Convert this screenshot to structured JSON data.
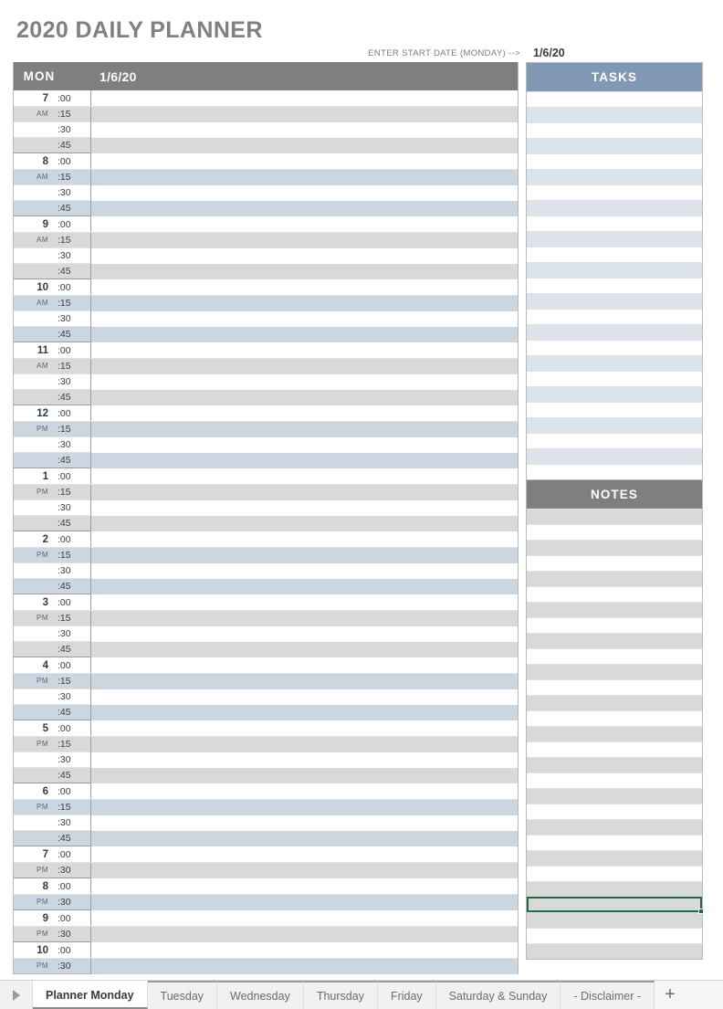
{
  "page": {
    "title": "2020 DAILY PLANNER"
  },
  "start_date": {
    "label": "ENTER START DATE (MONDAY) -->",
    "value": "1/6/20"
  },
  "schedule": {
    "day_abbr": "MON",
    "day_date": "1/6/20",
    "minute_quarters": [
      ":00",
      ":15",
      ":30",
      ":45"
    ],
    "minute_halves": [
      ":00",
      ":30"
    ],
    "hours": [
      {
        "hour": "7",
        "ampm": "AM",
        "tint": "gray",
        "slots": [
          ":00",
          ":15",
          ":30",
          ":45"
        ]
      },
      {
        "hour": "8",
        "ampm": "AM",
        "tint": "blue",
        "slots": [
          ":00",
          ":15",
          ":30",
          ":45"
        ]
      },
      {
        "hour": "9",
        "ampm": "AM",
        "tint": "gray",
        "slots": [
          ":00",
          ":15",
          ":30",
          ":45"
        ]
      },
      {
        "hour": "10",
        "ampm": "AM",
        "tint": "blue",
        "slots": [
          ":00",
          ":15",
          ":30",
          ":45"
        ]
      },
      {
        "hour": "11",
        "ampm": "AM",
        "tint": "gray",
        "slots": [
          ":00",
          ":15",
          ":30",
          ":45"
        ]
      },
      {
        "hour": "12",
        "ampm": "PM",
        "tint": "blue",
        "slots": [
          ":00",
          ":15",
          ":30",
          ":45"
        ]
      },
      {
        "hour": "1",
        "ampm": "PM",
        "tint": "gray",
        "slots": [
          ":00",
          ":15",
          ":30",
          ":45"
        ]
      },
      {
        "hour": "2",
        "ampm": "PM",
        "tint": "blue",
        "slots": [
          ":00",
          ":15",
          ":30",
          ":45"
        ]
      },
      {
        "hour": "3",
        "ampm": "PM",
        "tint": "gray",
        "slots": [
          ":00",
          ":15",
          ":30",
          ":45"
        ]
      },
      {
        "hour": "4",
        "ampm": "PM",
        "tint": "blue",
        "slots": [
          ":00",
          ":15",
          ":30",
          ":45"
        ]
      },
      {
        "hour": "5",
        "ampm": "PM",
        "tint": "gray",
        "slots": [
          ":00",
          ":15",
          ":30",
          ":45"
        ]
      },
      {
        "hour": "6",
        "ampm": "PM",
        "tint": "blue",
        "slots": [
          ":00",
          ":15",
          ":30",
          ":45"
        ]
      },
      {
        "hour": "7",
        "ampm": "PM",
        "tint": "gray",
        "slots": [
          ":00",
          ":30"
        ]
      },
      {
        "hour": "8",
        "ampm": "PM",
        "tint": "blue",
        "slots": [
          ":00",
          ":30"
        ]
      },
      {
        "hour": "9",
        "ampm": "PM",
        "tint": "gray",
        "slots": [
          ":00",
          ":30"
        ]
      },
      {
        "hour": "10",
        "ampm": "PM",
        "tint": "blue",
        "slots": [
          ":00",
          ":30"
        ]
      }
    ]
  },
  "tasks_panel": {
    "header": "TASKS",
    "header_color": "#8199b4",
    "row_count": 25,
    "rows": [
      "",
      "",
      "",
      "",
      "",
      "",
      "",
      "",
      "",
      "",
      "",
      "",
      "",
      "",
      "",
      "",
      "",
      "",
      "",
      "",
      "",
      "",
      "",
      "",
      ""
    ]
  },
  "notes_panel": {
    "header": "NOTES",
    "header_color": "#7f7f7f",
    "row_count": 29,
    "selected_row_index": 25,
    "rows": [
      "",
      "",
      "",
      "",
      "",
      "",
      "",
      "",
      "",
      "",
      "",
      "",
      "",
      "",
      "",
      "",
      "",
      "",
      "",
      "",
      "",
      "",
      "",
      "",
      "",
      "",
      "",
      "",
      ""
    ]
  },
  "tab_bar": {
    "scroll_left_icon": "triangle-right-icon",
    "add_label": "+",
    "tabs": [
      {
        "label": "Planner Monday",
        "active": true
      },
      {
        "label": "Tuesday",
        "active": false
      },
      {
        "label": "Wednesday",
        "active": false
      },
      {
        "label": "Thursday",
        "active": false
      },
      {
        "label": "Friday",
        "active": false
      },
      {
        "label": "Saturday & Sunday",
        "active": false
      },
      {
        "label": "- Disclaimer -",
        "active": false
      }
    ]
  },
  "colors": {
    "header_gray": "#7f7f7f",
    "tasks_blue": "#8199b4",
    "tint_gray": "#d9d9d9",
    "tint_blue": "#ccd6e0",
    "selection_green": "#1e6b43",
    "title_gray": "#808080"
  }
}
